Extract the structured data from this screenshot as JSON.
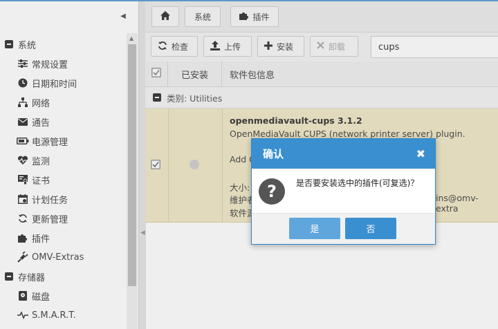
{
  "sidebar": {
    "items": [
      {
        "label": "系统",
        "icon": "minus-square-icon",
        "type": "group"
      },
      {
        "label": "常规设置",
        "icon": "sliders-icon",
        "type": "child"
      },
      {
        "label": "日期和时间",
        "icon": "clock-icon",
        "type": "child"
      },
      {
        "label": "网络",
        "icon": "network-icon",
        "type": "child"
      },
      {
        "label": "通告",
        "icon": "envelope-icon",
        "type": "child"
      },
      {
        "label": "电源管理",
        "icon": "battery-icon",
        "type": "child"
      },
      {
        "label": "监测",
        "icon": "heartbeat-icon",
        "type": "child"
      },
      {
        "label": "证书",
        "icon": "certificate-icon",
        "type": "child"
      },
      {
        "label": "计划任务",
        "icon": "calendar-icon",
        "type": "child"
      },
      {
        "label": "更新管理",
        "icon": "refresh-icon",
        "type": "child"
      },
      {
        "label": "插件",
        "icon": "puzzle-icon",
        "type": "child"
      },
      {
        "label": "OMV-Extras",
        "icon": "plug-icon",
        "type": "child"
      },
      {
        "label": "存储器",
        "icon": "minus-square-icon",
        "type": "group"
      },
      {
        "label": "磁盘",
        "icon": "disk-icon",
        "type": "child"
      },
      {
        "label": "S.M.A.R.T.",
        "icon": "pulse-icon",
        "type": "child"
      }
    ]
  },
  "breadcrumb": {
    "items": [
      "系统",
      "插件"
    ]
  },
  "toolbar": {
    "check_label": "检查",
    "upload_label": "上传",
    "install_label": "安装",
    "uninstall_label": "卸载",
    "search_value": "cups"
  },
  "grid": {
    "col_installed": "已安装",
    "col_info": "软件包信息",
    "group_label": "类别: Utilities",
    "row": {
      "title": "openmediavault-cups 3.1.2",
      "description": "OpenMediaVault CUPS (network printer server) plugin.",
      "frag_add": "Add C",
      "frag_size": "大小:",
      "frag_maintainer": "维护者",
      "frag_email": "ins@omv-extra",
      "frag_source": "软件源"
    }
  },
  "dialog": {
    "title": "确认",
    "message": "是否要安装选中的插件(可复选)？",
    "yes_label": "是",
    "no_label": "否"
  },
  "colors": {
    "accent": "#3a8fd0",
    "selected_row": "#efe7c6"
  }
}
